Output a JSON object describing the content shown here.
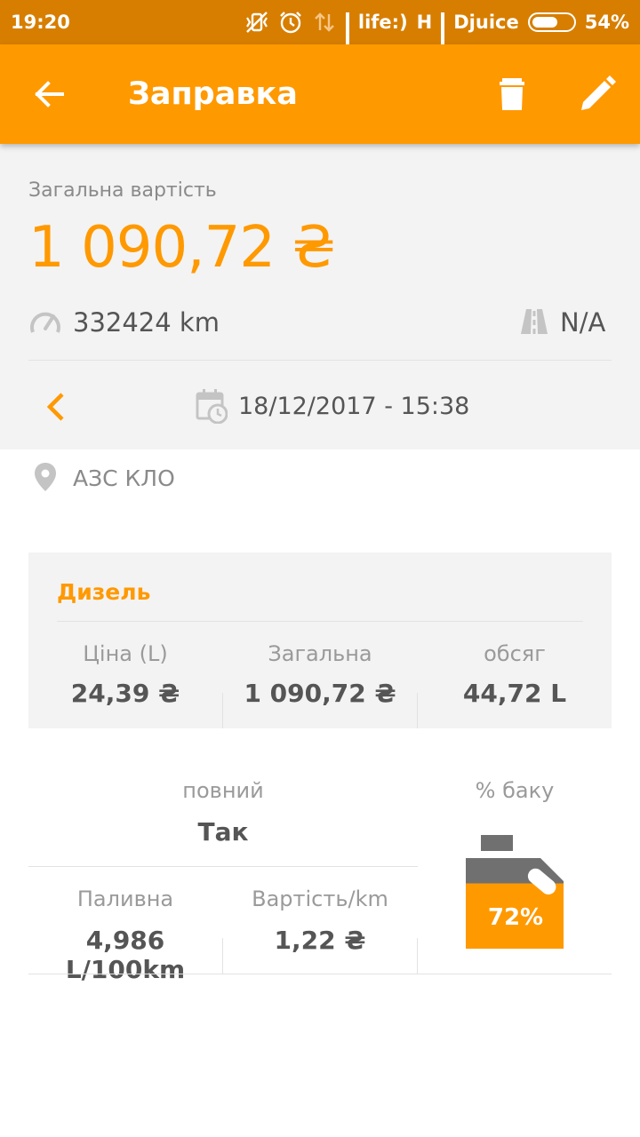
{
  "status_bar": {
    "time": "19:20",
    "carrier1": "life:)",
    "network_type": "H",
    "carrier2": "Djuice",
    "battery": "54%"
  },
  "app_bar": {
    "title": "Заправка"
  },
  "summary": {
    "total_label": "Загальна вартість",
    "total_amount": "1 090,72 ₴",
    "odometer": "332424 km",
    "route": "N/A",
    "datetime": "18/12/2017 - 15:38"
  },
  "location": "АЗС КЛО",
  "fuel": {
    "name": "Дизель",
    "columns": [
      {
        "header": "Ціна (L)",
        "value": "24,39 ₴"
      },
      {
        "header": "Загальна",
        "value": "1 090,72 ₴"
      },
      {
        "header": "обсяг",
        "value": "44,72 L"
      }
    ]
  },
  "stats": {
    "full_label": "повний",
    "full_value": "Так",
    "consumption_label": "Паливна",
    "consumption_value": "4,986 L/100km",
    "cost_per_km_label": "Вартість/km",
    "cost_per_km_value": "1,22 ₴",
    "tank_label": "% баку",
    "tank_value": "72%",
    "tank_fraction": 0.72
  },
  "colors": {
    "accent": "#ff9900",
    "status_bar": "#d77e00",
    "card_bg": "#f3f3f3"
  }
}
